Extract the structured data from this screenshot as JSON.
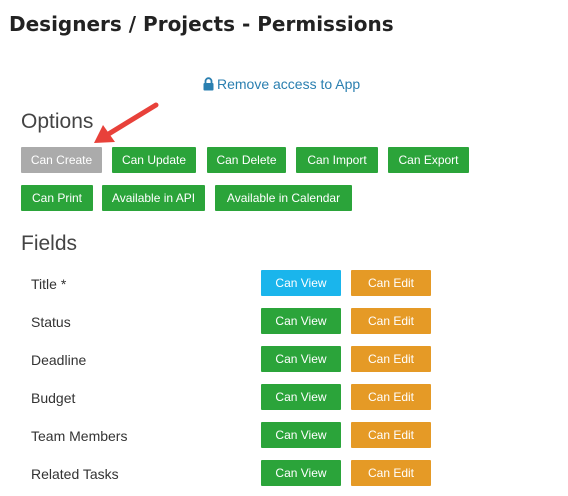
{
  "header": {
    "title": "Designers / Projects - Permissions"
  },
  "remove_access": {
    "label": "Remove access to App",
    "icon": "lock-icon"
  },
  "options": {
    "heading": "Options",
    "buttons": [
      {
        "label": "Can Create",
        "state": "inactive"
      },
      {
        "label": "Can Update",
        "state": "active"
      },
      {
        "label": "Can Delete",
        "state": "active"
      },
      {
        "label": "Can Import",
        "state": "active"
      },
      {
        "label": "Can Export",
        "state": "active"
      },
      {
        "label": "Can Print",
        "state": "active"
      },
      {
        "label": "Available in API",
        "state": "active"
      },
      {
        "label": "Available in Calendar",
        "state": "active"
      }
    ]
  },
  "fields": {
    "heading": "Fields",
    "rows": [
      {
        "label": "Title *",
        "view": "Can View",
        "edit": "Can Edit"
      },
      {
        "label": "Status",
        "view": "Can View",
        "edit": "Can Edit"
      },
      {
        "label": "Deadline",
        "view": "Can View",
        "edit": "Can Edit"
      },
      {
        "label": "Budget",
        "view": "Can View",
        "edit": "Can Edit"
      },
      {
        "label": "Team Members",
        "view": "Can View",
        "edit": "Can Edit"
      },
      {
        "label": "Related Tasks",
        "view": "Can View",
        "edit": "Can Edit"
      }
    ]
  },
  "colors": {
    "active_green": "#2ba43a",
    "inactive_gray": "#ababab",
    "view_highlight_blue": "#1ab5ec",
    "edit_orange": "#e59a26",
    "link_blue": "#2a7fb0",
    "annotation_red": "#e8413a"
  }
}
